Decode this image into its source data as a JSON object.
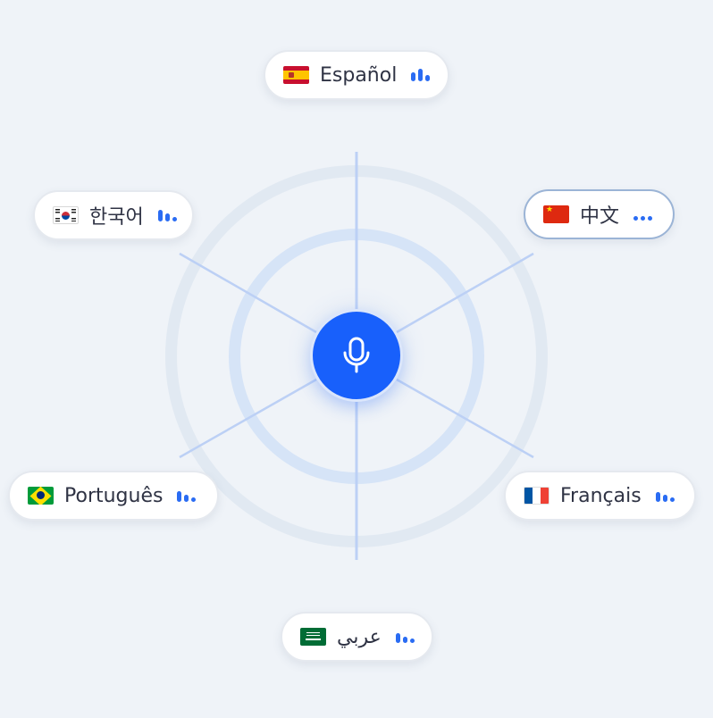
{
  "languages": {
    "spanish": {
      "label": "Español",
      "flag": "spain-flag-icon"
    },
    "korean": {
      "label": "한국어",
      "flag": "south-korea-flag-icon"
    },
    "chinese": {
      "label": "中文",
      "flag": "china-flag-icon",
      "selected": true
    },
    "portuguese": {
      "label": "Português",
      "flag": "brazil-flag-icon"
    },
    "french": {
      "label": "Français",
      "flag": "france-flag-icon"
    },
    "arabic": {
      "label": "عربي",
      "flag": "saudi-arabia-flag-icon"
    }
  },
  "center": {
    "icon": "microphone-icon"
  },
  "colors": {
    "accent": "#1860fb",
    "background": "#eff3f8",
    "text": "#2f3344",
    "spoke": "#bcd0f5",
    "selected_border": "#9bb4d6"
  }
}
